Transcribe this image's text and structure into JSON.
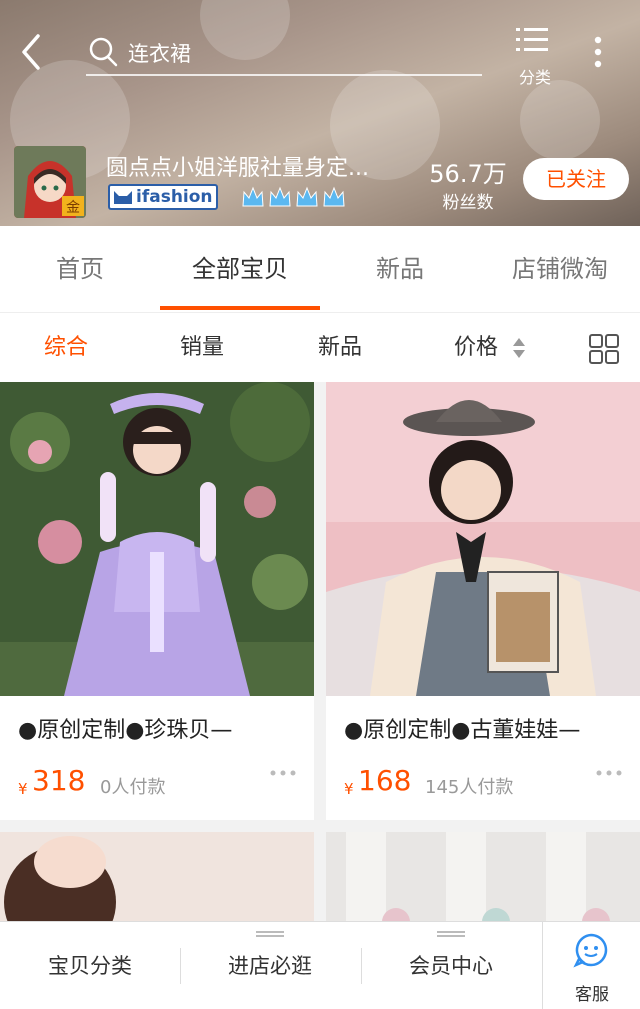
{
  "header": {
    "search_text": "连衣裙",
    "category_label": "分类"
  },
  "shop": {
    "name": "圆点点小姐洋服社量身定...",
    "logo_badge": "金",
    "ifashion_label": "ifashion",
    "fans_count": "56.7万",
    "fans_label": "粉丝数",
    "follow_label": "已关注"
  },
  "main_tabs": [
    {
      "label": "首页"
    },
    {
      "label": "全部宝贝"
    },
    {
      "label": "新品"
    },
    {
      "label": "店铺微淘"
    }
  ],
  "sort": {
    "items": [
      {
        "label": "综合"
      },
      {
        "label": "销量"
      },
      {
        "label": "新品"
      },
      {
        "label": "价格"
      }
    ]
  },
  "products": [
    {
      "title": "●原创定制●珍珠贝—",
      "currency": "¥",
      "price": "318",
      "sales": "0人付款"
    },
    {
      "title": "●原创定制●古董娃娃—",
      "currency": "¥",
      "price": "168",
      "sales": "145人付款"
    }
  ],
  "bottom_bar": {
    "items": [
      {
        "label": "宝贝分类"
      },
      {
        "label": "进店必逛"
      },
      {
        "label": "会员中心"
      }
    ],
    "service_label": "客服"
  },
  "colors": {
    "accent": "#ff5000",
    "service_blue": "#2f8ff0"
  }
}
